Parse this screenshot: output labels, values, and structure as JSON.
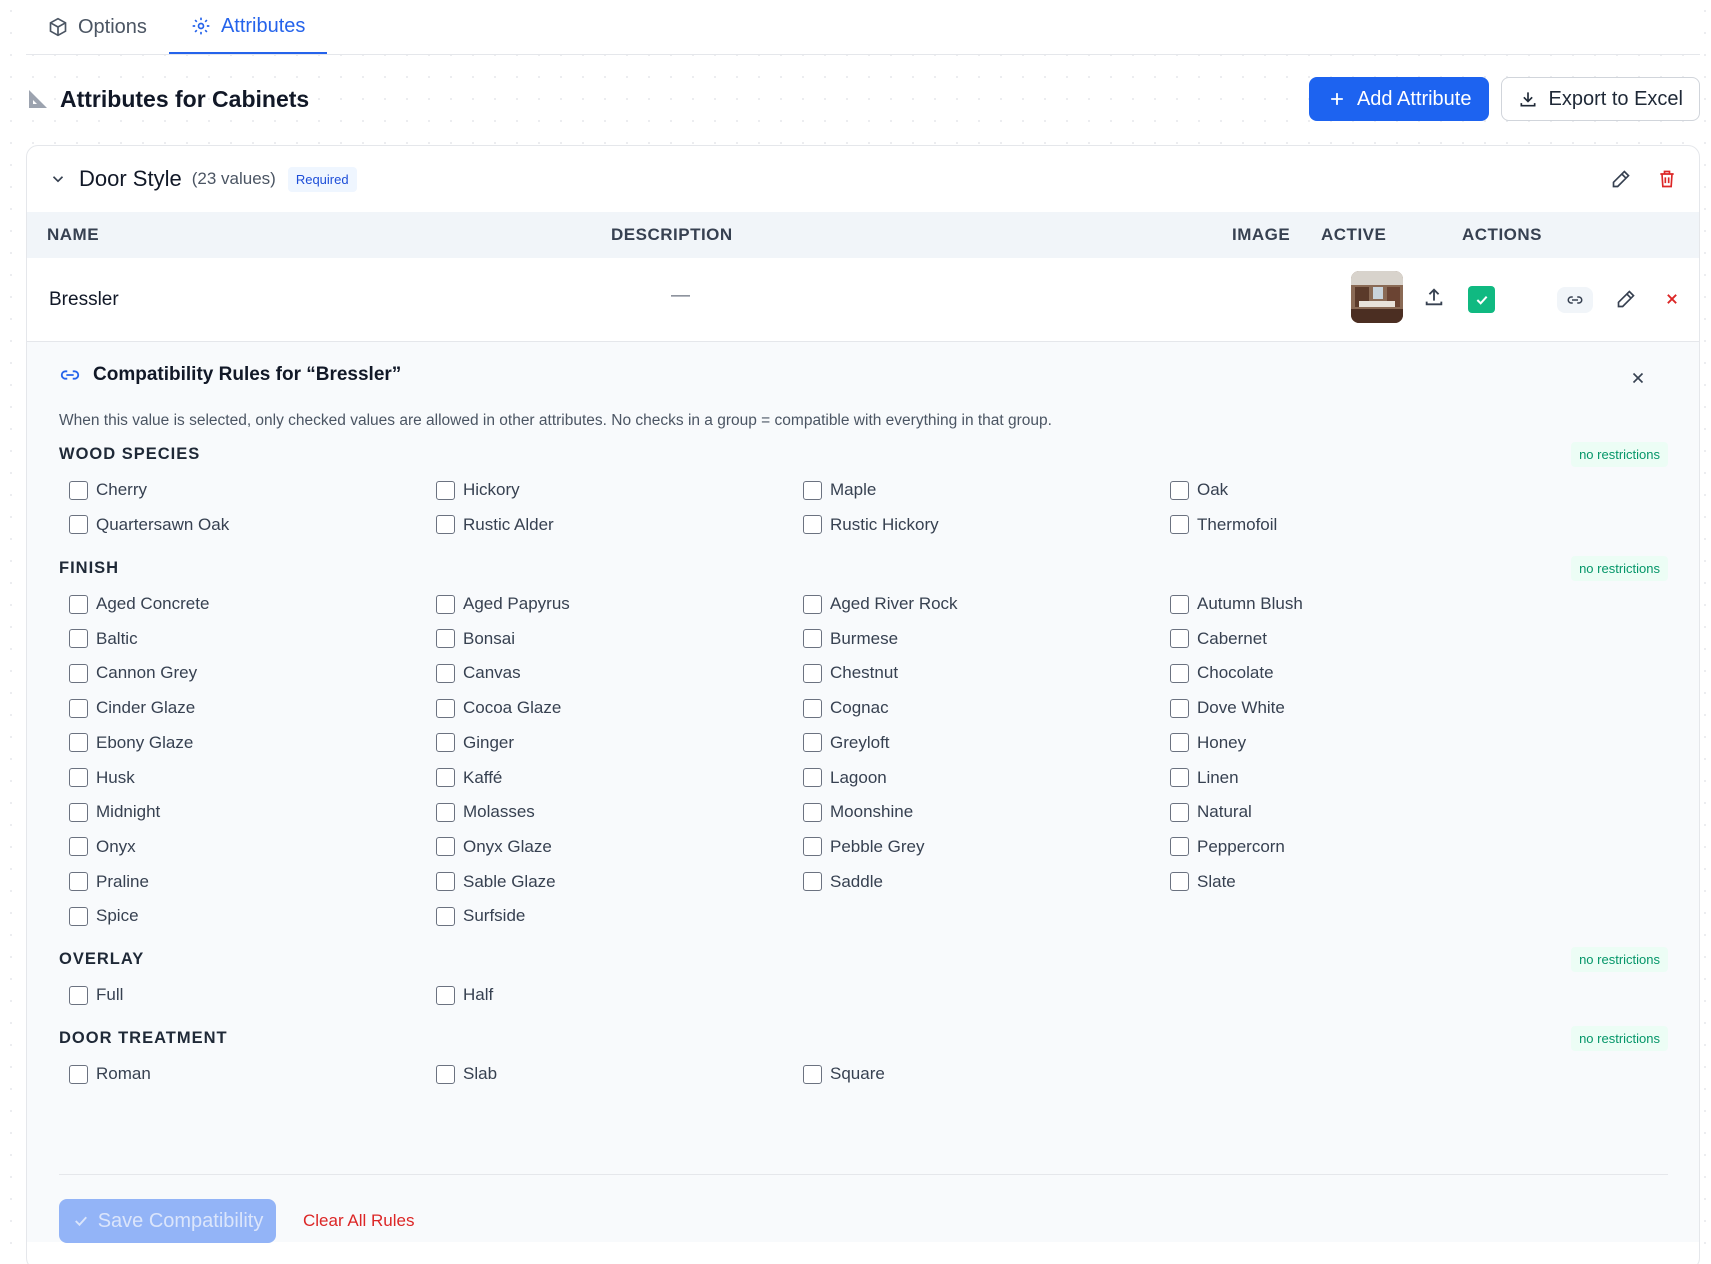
{
  "tabs": [
    {
      "label": "Options",
      "icon": "package-icon",
      "active": false
    },
    {
      "label": "Attributes",
      "icon": "gear-icon",
      "active": true
    }
  ],
  "header": {
    "title": "Attributes for Cabinets",
    "add_label": "Add Attribute",
    "export_label": "Export to Excel"
  },
  "attribute": {
    "name": "Door Style",
    "count": "(23 values)",
    "required_badge": "Required"
  },
  "table": {
    "columns": {
      "name": "NAME",
      "description": "DESCRIPTION",
      "image": "IMAGE",
      "active": "ACTIVE",
      "actions": "ACTIONS"
    },
    "row": {
      "name": "Bressler",
      "description": "—",
      "active": true
    }
  },
  "compat": {
    "title": "Compatibility Rules for “Bressler”",
    "description": "When this value is selected, only checked values are allowed in other attributes. No checks in a group = compatible with everything in that group.",
    "badge": "no restrictions",
    "save_label": "Save Compatibility",
    "clear_label": "Clear All Rules",
    "groups": [
      {
        "name": "WOOD SPECIES",
        "options": [
          "Cherry",
          "Hickory",
          "Maple",
          "Oak",
          "Quartersawn Oak",
          "Rustic Alder",
          "Rustic Hickory",
          "Thermofoil"
        ]
      },
      {
        "name": "FINISH",
        "options": [
          "Aged Concrete",
          "Aged Papyrus",
          "Aged River Rock",
          "Autumn Blush",
          "Baltic",
          "Bonsai",
          "Burmese",
          "Cabernet",
          "Cannon Grey",
          "Canvas",
          "Chestnut",
          "Chocolate",
          "Cinder Glaze",
          "Cocoa Glaze",
          "Cognac",
          "Dove White",
          "Ebony Glaze",
          "Ginger",
          "Greyloft",
          "Honey",
          "Husk",
          "Kaffé",
          "Lagoon",
          "Linen",
          "Midnight",
          "Molasses",
          "Moonshine",
          "Natural",
          "Onyx",
          "Onyx Glaze",
          "Pebble Grey",
          "Peppercorn",
          "Praline",
          "Sable Glaze",
          "Saddle",
          "Slate",
          "Spice",
          "Surfside"
        ]
      },
      {
        "name": "OVERLAY",
        "options": [
          "Full",
          "Half"
        ]
      },
      {
        "name": "DOOR TREATMENT",
        "options": [
          "Roman",
          "Slab",
          "Square"
        ]
      }
    ]
  },
  "colors": {
    "accent": "#1d63f0",
    "active": "#10b981",
    "danger": "#dc2626",
    "restriction": "#059669"
  }
}
